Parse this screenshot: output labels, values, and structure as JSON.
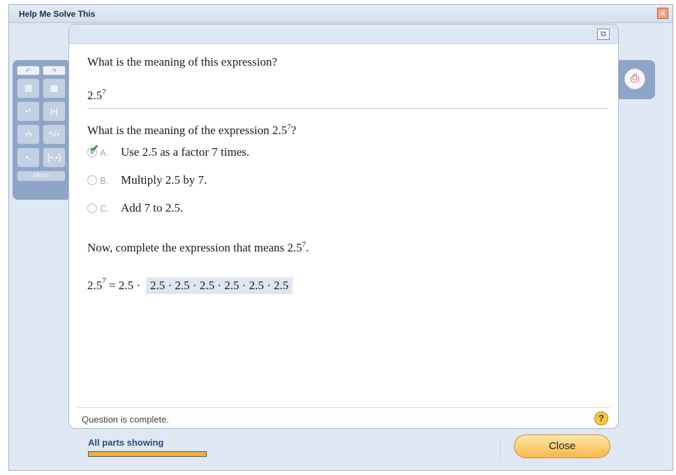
{
  "window": {
    "title": "Help Me Solve This",
    "close_glyph": "×"
  },
  "toolbar": {
    "undo": "↶",
    "redo": "↷",
    "buttons": [
      "▤",
      "▦",
      "▪ⁿ",
      "|▪|",
      "√▪",
      "ⁿ√▪",
      "▪,",
      "(▪,▪)"
    ],
    "more_label": "More"
  },
  "print": {
    "icon": "print-icon"
  },
  "question": {
    "prompt": "What is the meaning of this expression?",
    "expr_base": "2.5",
    "expr_exp": "7"
  },
  "part1": {
    "prompt_text": "What is the meaning of the expression 2.5",
    "prompt_exp": "7",
    "prompt_end": "?",
    "options": [
      {
        "letter": "A.",
        "text": "Use 2.5 as a factor 7 times.",
        "selected": true
      },
      {
        "letter": "B.",
        "text": "Multiply 2.5 by 7.",
        "selected": false
      },
      {
        "letter": "C.",
        "text": "Add 7 to 2.5.",
        "selected": false
      }
    ]
  },
  "part2": {
    "prompt_text": "Now, complete the expression that means 2.5",
    "prompt_exp": "7",
    "prompt_end": ".",
    "lhs_base": "2.5",
    "lhs_exp": "7",
    "lhs_rest": "= 2.5 ·",
    "answer": "2.5 · 2.5 · 2.5 · 2.5 · 2.5 · 2.5"
  },
  "status": {
    "text": "Question is complete.",
    "help_glyph": "?"
  },
  "footer": {
    "parts_label": "All parts showing",
    "progress": 1.0,
    "close_label": "Close"
  },
  "colors": {
    "accent": "#f2b233",
    "check": "#2e9e3a",
    "panel_bg": "#dfe8f3"
  }
}
